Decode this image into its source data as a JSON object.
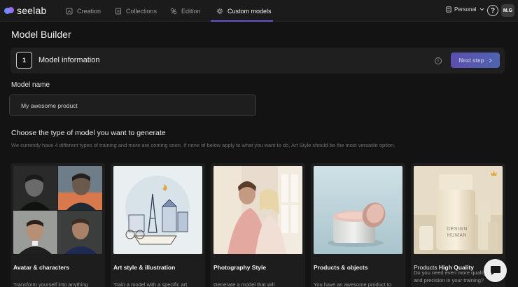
{
  "app": {
    "logo_text": "seelab"
  },
  "nav": {
    "items": [
      {
        "label": "Creation",
        "icon": "creation-icon"
      },
      {
        "label": "Collections",
        "icon": "collections-icon"
      },
      {
        "label": "Edition",
        "icon": "edition-icon"
      },
      {
        "label": "Custom models",
        "icon": "custom-models-icon",
        "active": true
      }
    ],
    "workspace": "Personal",
    "help_label": "?",
    "avatar_initials": "M.G"
  },
  "page": {
    "title": "Model Builder"
  },
  "step": {
    "number": "1",
    "title": "Model information",
    "next_label": "Next step"
  },
  "form": {
    "name_label": "Model name",
    "name_value": "My awesome product"
  },
  "types": {
    "title": "Choose the type of model you want to generate",
    "subtitle": "We currently have 4 different types of training and more are coming soon. If none of below apply to what you want to do, Art Style should be the most versatile option.",
    "cards": [
      {
        "title": "Avatar & characters",
        "desc": "Transform yourself into anything"
      },
      {
        "title": "Art style & illustration",
        "desc": "Train a model with a specific art"
      },
      {
        "title": "Photography Style",
        "desc": "Generate a model that will"
      },
      {
        "title": "Products & objects",
        "desc": "You have an awesome product to"
      },
      {
        "title_prefix": "Products ",
        "title_emph": "High Quality",
        "desc": "Do you need even more quality and precision in your training?",
        "badge": "crown-icon",
        "product_text_1": "DESIGN",
        "product_text_2": "HUMAN"
      }
    ]
  },
  "colors": {
    "accent": "#6b4fd8",
    "background": "#131313",
    "card": "#1d1d1d"
  }
}
